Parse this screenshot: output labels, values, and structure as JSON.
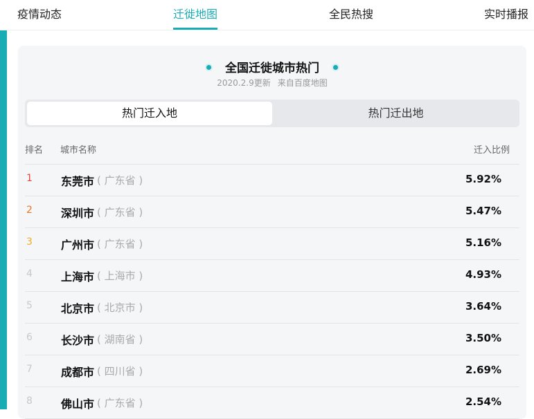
{
  "nav": {
    "tabs": [
      {
        "label": "疫情动态"
      },
      {
        "label": "迁徙地图"
      },
      {
        "label": "全民热搜"
      },
      {
        "label": "实时播报"
      }
    ],
    "active_index": 1
  },
  "card": {
    "title": "全国迁徙城市热门",
    "subtitle_date": "2020.2.9更新",
    "subtitle_source": "来自百度地图",
    "segments": [
      "热门迁入地",
      "热门迁出地"
    ],
    "active_segment": 0,
    "table": {
      "headers": {
        "rank": "排名",
        "city": "城市名称",
        "ratio": "迁入比例"
      },
      "rows": [
        {
          "rank": "1",
          "city": "东莞市",
          "province": "( 广东省 )",
          "ratio": "5.92%"
        },
        {
          "rank": "2",
          "city": "深圳市",
          "province": "( 广东省 )",
          "ratio": "5.47%"
        },
        {
          "rank": "3",
          "city": "广州市",
          "province": "( 广东省 )",
          "ratio": "5.16%"
        },
        {
          "rank": "4",
          "city": "上海市",
          "province": "( 上海市 )",
          "ratio": "4.93%"
        },
        {
          "rank": "5",
          "city": "北京市",
          "province": "( 北京市 )",
          "ratio": "3.64%"
        },
        {
          "rank": "6",
          "city": "长沙市",
          "province": "( 湖南省 )",
          "ratio": "3.50%"
        },
        {
          "rank": "7",
          "city": "成都市",
          "province": "( 四川省 )",
          "ratio": "2.69%"
        },
        {
          "rank": "8",
          "city": "佛山市",
          "province": "( 广东省 )",
          "ratio": "2.54%"
        }
      ]
    }
  },
  "colors": {
    "accent": "#1aacb4",
    "rank1": "#e8453c",
    "rank2": "#f07622",
    "rank3": "#f5ac26"
  }
}
